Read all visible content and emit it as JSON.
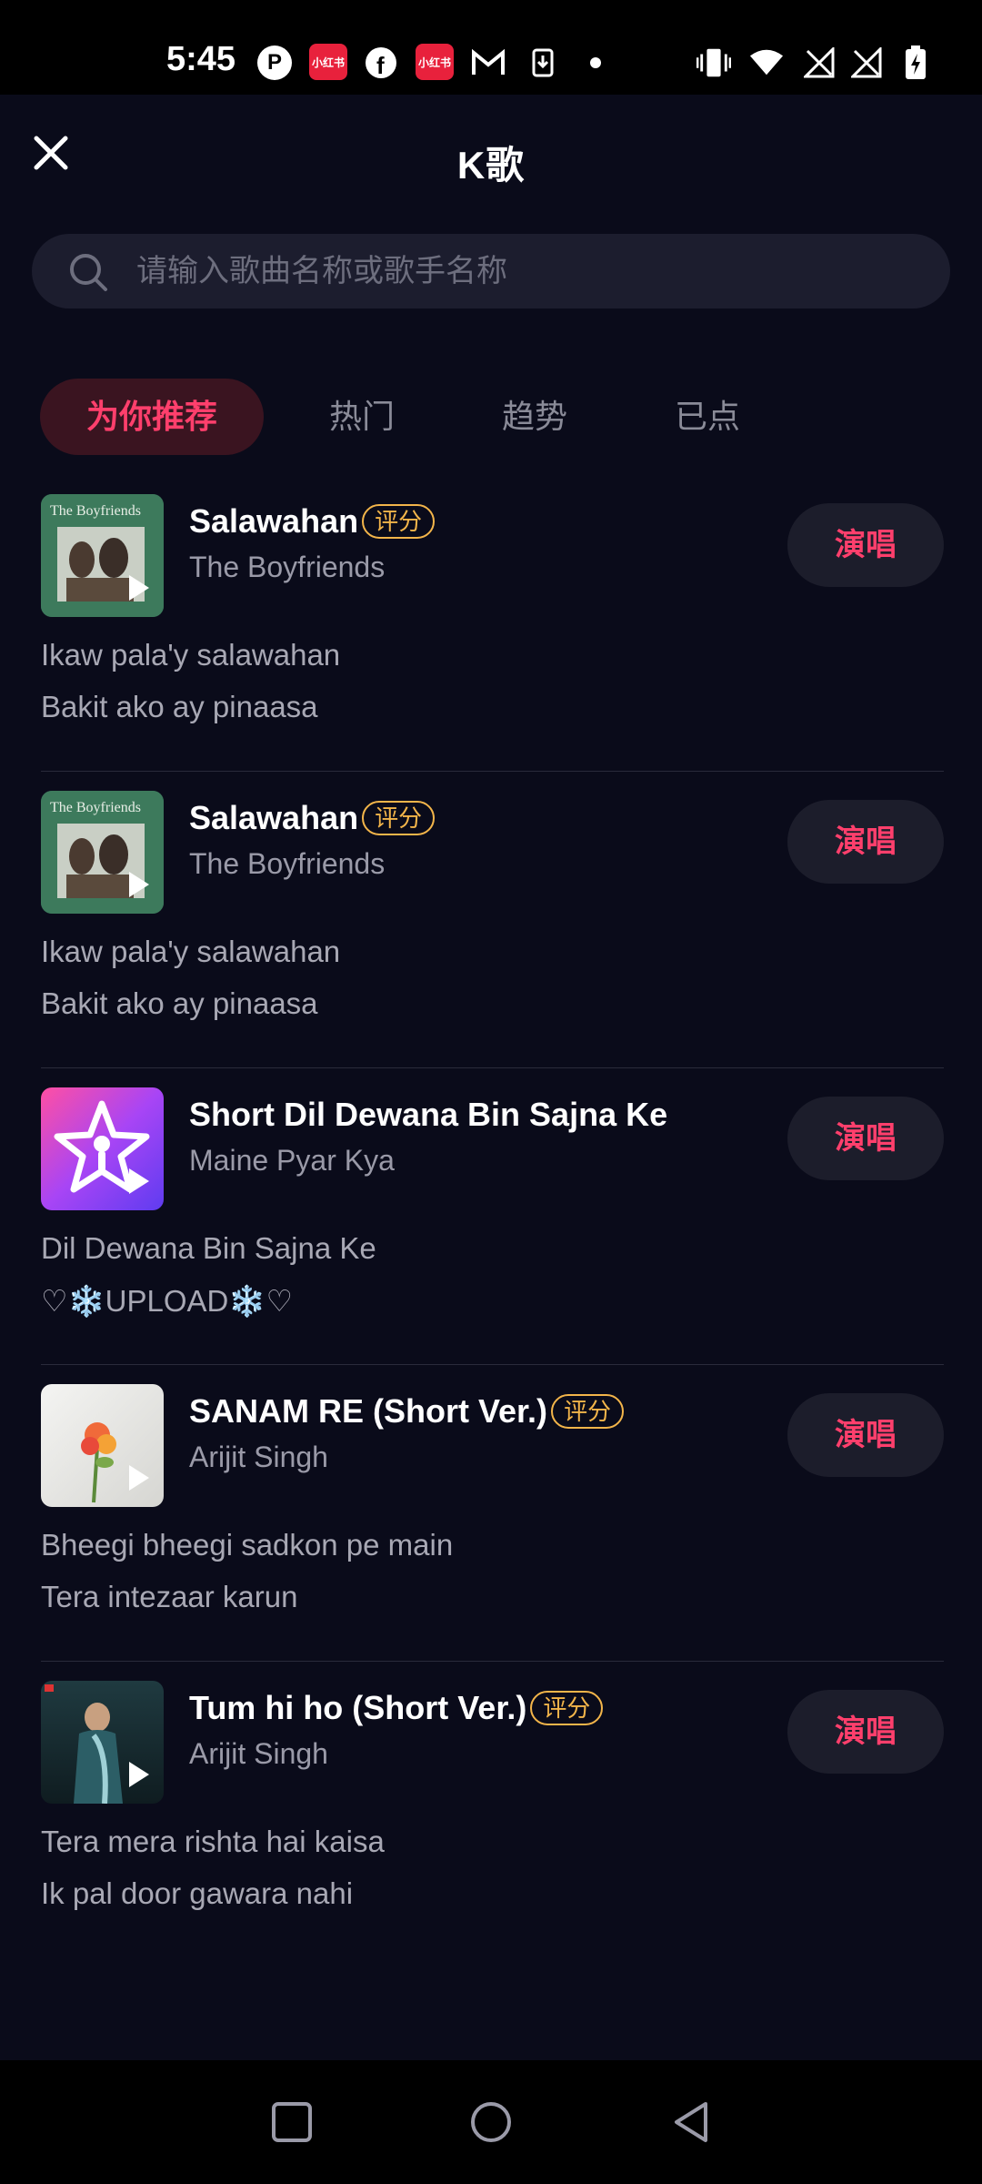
{
  "status_bar": {
    "time": "5:45",
    "icons": [
      "p-icon",
      "xiaohongshu-icon",
      "facebook-icon",
      "xiaohongshu-icon",
      "gmail-icon",
      "download-icon",
      "dot-icon",
      "vibrate-icon",
      "wifi-icon",
      "no-signal-icon",
      "no-signal-icon",
      "battery-charging-icon"
    ],
    "red_app_label": "小红书"
  },
  "header": {
    "title": "K歌"
  },
  "search": {
    "placeholder": "请输入歌曲名称或歌手名称"
  },
  "tabs": [
    {
      "label": "为你推荐",
      "active": true
    },
    {
      "label": "热门",
      "active": false
    },
    {
      "label": "趋势",
      "active": false
    },
    {
      "label": "已点",
      "active": false
    }
  ],
  "songs": [
    {
      "title": "Salawahan",
      "badge": "评分",
      "artist": "The Boyfriends",
      "sing_label": "演唱",
      "lyric1": "Ikaw pala'y salawahan",
      "lyric2": "Bakit ako ay pinaasa",
      "cover_text": "The Boyfriends",
      "cover": "green-album"
    },
    {
      "title": "Salawahan",
      "badge": "评分",
      "artist": "The Boyfriends",
      "sing_label": "演唱",
      "lyric1": "Ikaw pala'y salawahan",
      "lyric2": "Bakit ako ay pinaasa",
      "cover_text": "The Boyfriends",
      "cover": "green-album"
    },
    {
      "title": "Short Dil Dewana Bin Sajna Ke",
      "badge": "",
      "artist": "Maine Pyar Kya",
      "sing_label": "演唱",
      "lyric1": "Dil Dewana Bin Sajna Ke",
      "lyric2": "♡❄️UPLOAD❄️♡",
      "cover": "starmaker-logo"
    },
    {
      "title": "SANAM RE (Short Ver.)",
      "badge": "评分",
      "artist": "Arijit Singh",
      "sing_label": "演唱",
      "lyric1": "Bheegi bheegi sadkon pe main",
      "lyric2": "Tera intezaar karun",
      "cover": "flower-cover"
    },
    {
      "title": "Tum hi ho (Short Ver.)",
      "badge": "评分",
      "artist": "Arijit Singh",
      "sing_label": "演唱",
      "lyric1": "Tera mera rishta hai kaisa",
      "lyric2": "Ik pal door gawara nahi",
      "cover": "movie-poster"
    }
  ],
  "colors": {
    "background": "#0a0b1a",
    "accent": "#ff3f6c",
    "badge": "#f3b54a"
  }
}
